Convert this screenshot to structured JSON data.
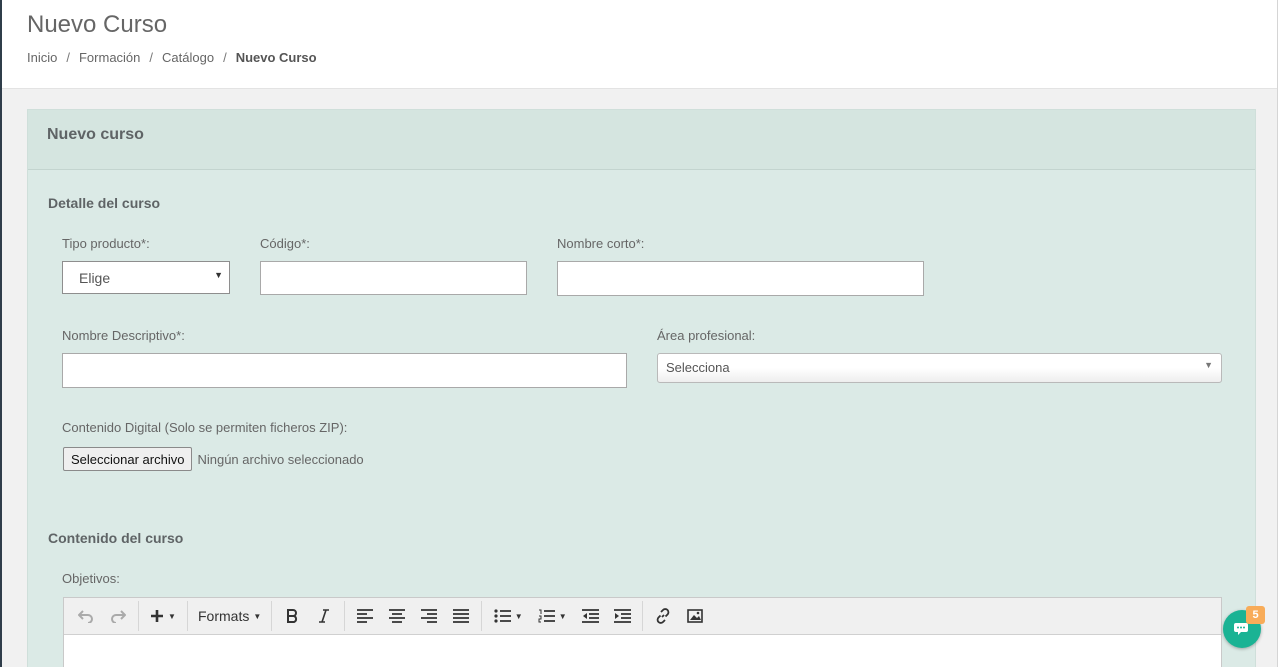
{
  "header": {
    "title": "Nuevo Curso",
    "breadcrumb": [
      "Inicio",
      "Formación",
      "Catálogo"
    ],
    "breadcrumb_current": "Nuevo Curso",
    "separator": "/"
  },
  "panel": {
    "title": "Nuevo curso",
    "detail_section": {
      "title": "Detalle del curso",
      "tipo_producto": {
        "label": "Tipo producto*:",
        "value": "Elige"
      },
      "codigo": {
        "label": "Código*:",
        "value": ""
      },
      "nombre_corto": {
        "label": "Nombre corto*:",
        "value": ""
      },
      "nombre_descriptivo": {
        "label": "Nombre Descriptivo*:",
        "value": ""
      },
      "area_profesional": {
        "label": "Área profesional:",
        "value": "Selecciona"
      },
      "contenido_digital": {
        "label": "Contenido Digital (Solo se permiten ficheros ZIP):",
        "button": "Seleccionar archivo",
        "status": "Ningún archivo seleccionado"
      }
    },
    "content_section": {
      "title": "Contenido del curso",
      "objetivos_label": "Objetivos:",
      "toolbar": {
        "formats_label": "Formats",
        "buttons": [
          "undo-icon",
          "redo-icon",
          "insert-icon",
          "bold-icon",
          "italic-icon",
          "align-left-icon",
          "align-center-icon",
          "align-right-icon",
          "align-justify-icon",
          "bullet-list-icon",
          "numbered-list-icon",
          "outdent-icon",
          "indent-icon",
          "link-icon",
          "image-icon"
        ]
      }
    }
  },
  "chat": {
    "badge_count": "5"
  },
  "colors": {
    "panel_bg": "#dbeae6",
    "panel_header_bg": "#d5e5e0",
    "chat_accent": "#1ab394",
    "badge": "#f8ac59",
    "sidebar_edge": "#2f3d4a"
  }
}
